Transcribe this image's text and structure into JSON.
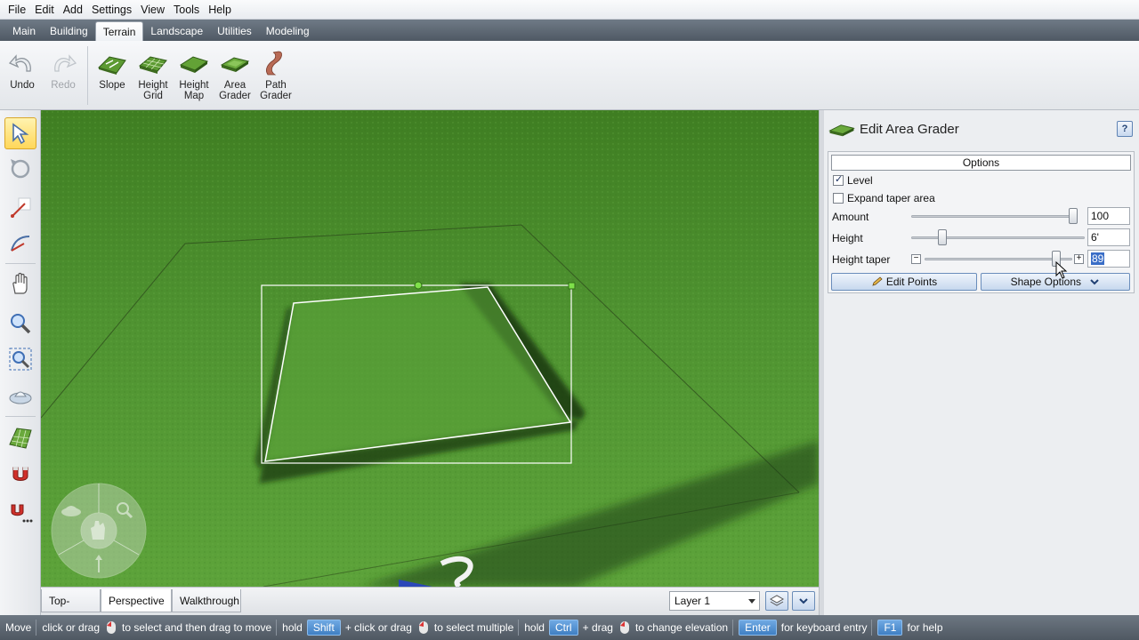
{
  "menu": [
    "File",
    "Edit",
    "Add",
    "Settings",
    "View",
    "Tools",
    "Help"
  ],
  "tabs": [
    {
      "label": "Main",
      "active": false
    },
    {
      "label": "Building",
      "active": false
    },
    {
      "label": "Terrain",
      "active": true
    },
    {
      "label": "Landscape",
      "active": false
    },
    {
      "label": "Utilities",
      "active": false
    },
    {
      "label": "Modeling",
      "active": false
    }
  ],
  "ribbon": {
    "undo": "Undo",
    "redo": "Redo",
    "slope": "Slope",
    "height_grid_1": "Height",
    "height_grid_2": "Grid",
    "height_map_1": "Height",
    "height_map_2": "Map",
    "area_grader_1": "Area",
    "area_grader_2": "Grader",
    "path_grader_1": "Path",
    "path_grader_2": "Grader"
  },
  "left_tools": [
    "select-arrow-icon",
    "rotate-icon",
    "line-icon",
    "arc-icon",
    "hand-pan-icon",
    "zoom-icon",
    "zoom-extents-icon",
    "orbit-icon",
    "grid-icon",
    "magnet-icon",
    "magnet-options-icon"
  ],
  "view_tabs": [
    "Top-Down",
    "Perspective",
    "Walkthrough"
  ],
  "active_view": "Perspective",
  "layer": "Layer 1",
  "panel": {
    "title": "Edit Area Grader",
    "help": "?",
    "options_header": "Options",
    "level_label": "Level",
    "level_checked": true,
    "expand_label": "Expand taper area",
    "expand_checked": false,
    "amount_label": "Amount",
    "amount_value": "100",
    "amount_fraction": 1.0,
    "height_label": "Height",
    "height_value": "6'",
    "height_fraction": 0.18,
    "taper_label": "Height taper",
    "taper_value": "89",
    "taper_fraction": 0.89,
    "edit_points": "Edit Points",
    "shape_options": "Shape Options"
  },
  "status": {
    "mode": "Move",
    "t1": "click or drag",
    "t2": "to select and then drag to move",
    "hold1": "hold",
    "key_shift": "Shift",
    "t3": "+ click or drag",
    "t4": "to select multiple",
    "hold2": "hold",
    "key_ctrl": "Ctrl",
    "t5": "+ drag",
    "t6": "to change elevation",
    "key_enter": "Enter",
    "t7": "for keyboard entry",
    "key_f1": "F1",
    "t8": "for help"
  },
  "colors": {
    "grass": "#4a8a2a",
    "selection": "#ffffff",
    "handle": "#7fe04a",
    "key_blue": "#4a8fd3"
  }
}
